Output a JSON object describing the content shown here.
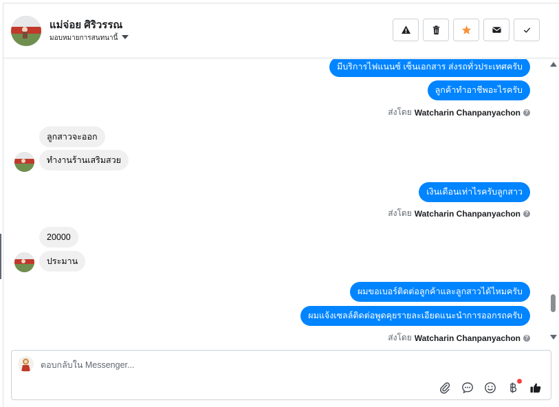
{
  "header": {
    "contact_name": "แม่จ่อย ศิริวรรณ",
    "assign_label": "มอบหมายการสนทนานี้"
  },
  "actions": [
    "warning-icon",
    "trash-icon",
    "star-icon",
    "envelope-icon",
    "check-icon"
  ],
  "colors": {
    "outgoing_bubble": "#0084ff",
    "incoming_bubble": "#f0f0f0",
    "star": "#f7923a",
    "like": "#1c1e21",
    "notification_dot": "#fa3e3e"
  },
  "messages": {
    "out_1": "มีบริการไฟแนนซ์ เซ็นเอกสาร ส่งรถทั่วประเทศครับ",
    "out_2": "ลูกค้าทำอาชีพอะไรครับ",
    "sent_by_1": {
      "prefix": "ส่งโดย",
      "sender": "Watcharin Chanpanyachon"
    },
    "in_1": "ลูกสาวจะออก",
    "in_2": "ทำงานร้านเสริมสวย",
    "out_3": "เงินเดือนเท่าไรครับลูกสาว",
    "sent_by_2": {
      "prefix": "ส่งโดย",
      "sender": "Watcharin Chanpanyachon"
    },
    "in_3": "20000",
    "in_4": "ประมาน",
    "out_4": "ผมขอเบอร์ติดต่อลูกค้าและลูกสาวได้ไหมครับ",
    "out_5": "ผมแจ้งเซลล์ติดต่อพูดคุยรายละเอียดแนะนำการออกรถครับ",
    "sent_by_3": {
      "prefix": "ส่งโดย",
      "sender": "Watcharin Chanpanyachon"
    }
  },
  "composer": {
    "placeholder": "ตอบกลับใน Messenger...",
    "tools": [
      "paperclip-icon",
      "chat-bubble-icon",
      "emoji-icon",
      "baht-icon",
      "thumbs-up-icon"
    ]
  }
}
